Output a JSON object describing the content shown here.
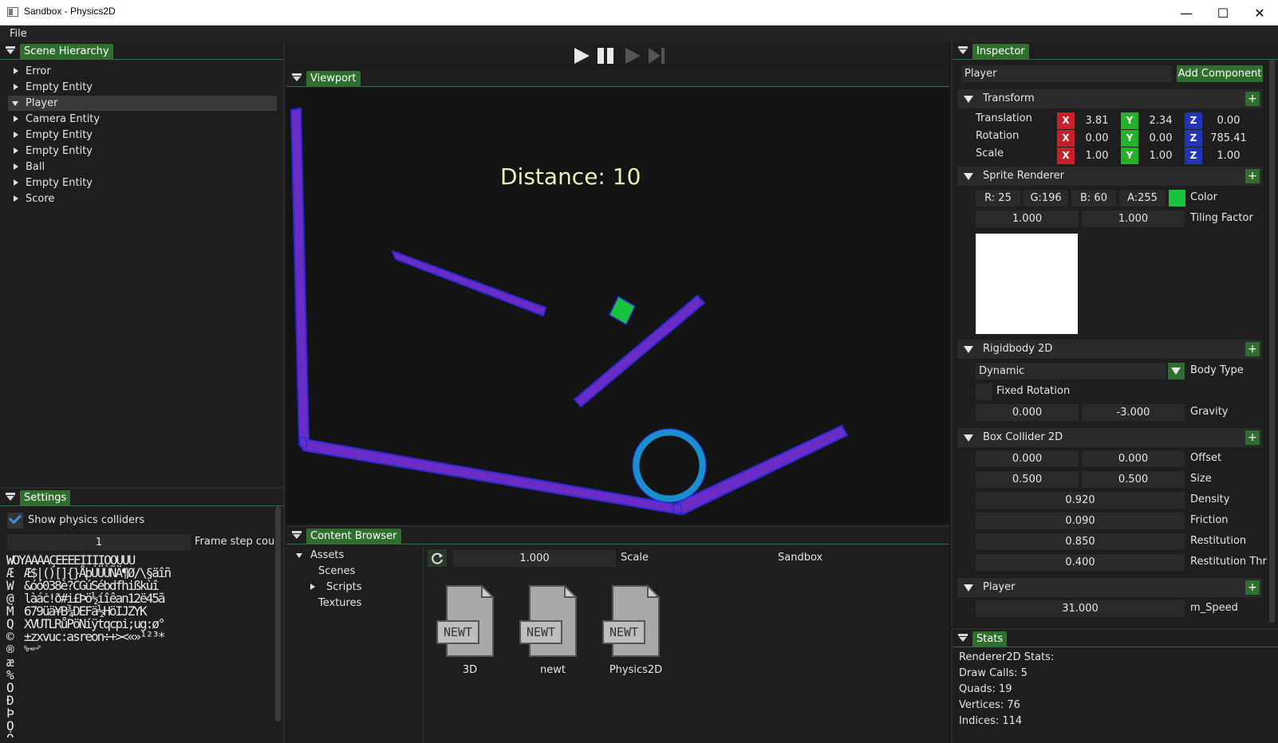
{
  "window": {
    "title": "Sandbox - Physics2D",
    "minimize": "—",
    "maximize": "☐",
    "close": "✕"
  },
  "menu": {
    "file": "File"
  },
  "hierarchy": {
    "title": "Scene Hierarchy",
    "items": [
      {
        "label": "Error",
        "expanded": false
      },
      {
        "label": "Empty Entity",
        "expanded": false
      },
      {
        "label": "Player",
        "expanded": true,
        "selected": true
      },
      {
        "label": "Camera Entity",
        "expanded": false
      },
      {
        "label": "Empty Entity",
        "expanded": false
      },
      {
        "label": "Empty Entity",
        "expanded": false
      },
      {
        "label": "Ball",
        "expanded": false
      },
      {
        "label": "Empty Entity",
        "expanded": false
      },
      {
        "label": "Score",
        "expanded": false
      }
    ]
  },
  "settings": {
    "title": "Settings",
    "show_colliders_label": "Show physics colliders",
    "show_colliders": true,
    "frame_step_value": "1",
    "frame_step_label": "Frame step cou",
    "atlas_rows": [
      "ŴÕÝÀÁÂÃÇÈÉÊËÌÍÎÏÒÓÙÚÛ",
      "Æ$|()[]{}ÅþÚÜÙÑÄ¶Ø/\\§äîñ",
      "&óó038è?CGúSébdfhißkùî",
      "làáċ!ð#i£Þö½íîêan12ë45ã",
      "679üä¥B¾DEFä½HöIJZYK",
      "XVUTLRůPöNíÿtqcpi;ug:ø°",
      "±zxvuc:asreon÷+><«»¹²³*",
      "%~=¬°"
    ],
    "atlas_column": "Ŵ\nÆ\nW\n@\nM\nQ\n©\n®\næ\n%\nO\nÐ\nÞ\nO\nÓ"
  },
  "toolbar": {
    "play_icon": "play-icon",
    "pause_icon": "pause-icon",
    "simulate_icon": "simulate-icon",
    "step_icon": "step-icon"
  },
  "viewport": {
    "title": "Viewport",
    "overlay_text": "Distance: 10",
    "colors": {
      "wall": "#6a2cc4",
      "wall_outline": "#2a2ad8",
      "player": "#19c43c",
      "ball_ring": "#1a8fd0",
      "background": "#141414"
    }
  },
  "content_browser": {
    "title": "Content Browser",
    "tree": [
      {
        "label": "Assets",
        "expanded": true,
        "level": 0
      },
      {
        "label": "Scenes",
        "level": 1
      },
      {
        "label": "Scripts",
        "expanded": false,
        "level": 1
      },
      {
        "label": "Textures",
        "level": 1
      }
    ],
    "scale_value": "1.000",
    "scale_label": "Scale",
    "path": "Sandbox",
    "icon_text": "NEWT",
    "files": [
      "3D",
      "newt",
      "Physics2D"
    ]
  },
  "inspector": {
    "title": "Inspector",
    "entity_name": "Player",
    "add_component": "Add Component",
    "plus": "+",
    "transform": {
      "title": "Transform",
      "rows": [
        {
          "label": "Translation",
          "x": "3.81",
          "y": "2.34",
          "z": "0.00"
        },
        {
          "label": "Rotation",
          "x": "0.00",
          "y": "0.00",
          "z": "785.41"
        },
        {
          "label": "Scale",
          "x": "1.00",
          "y": "1.00",
          "z": "1.00"
        }
      ],
      "axis": {
        "x": "X",
        "y": "Y",
        "z": "Z"
      }
    },
    "sprite": {
      "title": "Sprite Renderer",
      "r": "R: 25",
      "g": "G:196",
      "b": "B: 60",
      "a": "A:255",
      "swatch": "#19c43c",
      "color_label": "Color",
      "tiling_a": "1.000",
      "tiling_b": "1.000",
      "tiling_label": "Tiling Factor"
    },
    "rigidbody": {
      "title": "Rigidbody 2D",
      "body_type": "Dynamic",
      "body_type_label": "Body Type",
      "fixed_rotation_label": "Fixed Rotation",
      "fixed_rotation": false,
      "gravity_x": "0.000",
      "gravity_y": "-3.000",
      "gravity_label": "Gravity"
    },
    "box_collider": {
      "title": "Box Collider 2D",
      "offset_x": "0.000",
      "offset_y": "0.000",
      "offset_label": "Offset",
      "size_x": "0.500",
      "size_y": "0.500",
      "size_label": "Size",
      "density": "0.920",
      "density_label": "Density",
      "friction": "0.090",
      "friction_label": "Friction",
      "restitution": "0.850",
      "restitution_label": "Restitution",
      "restitution_thr": "0.400",
      "restitution_thr_label": "Restitution Thr"
    },
    "player_script": {
      "title": "Player",
      "speed": "31.000",
      "speed_label": "m_Speed"
    }
  },
  "stats": {
    "title": "Stats",
    "lines": [
      "Renderer2D Stats:",
      "Draw Calls: 5",
      "Quads: 19",
      "Vertices: 76",
      "Indices: 114"
    ]
  }
}
